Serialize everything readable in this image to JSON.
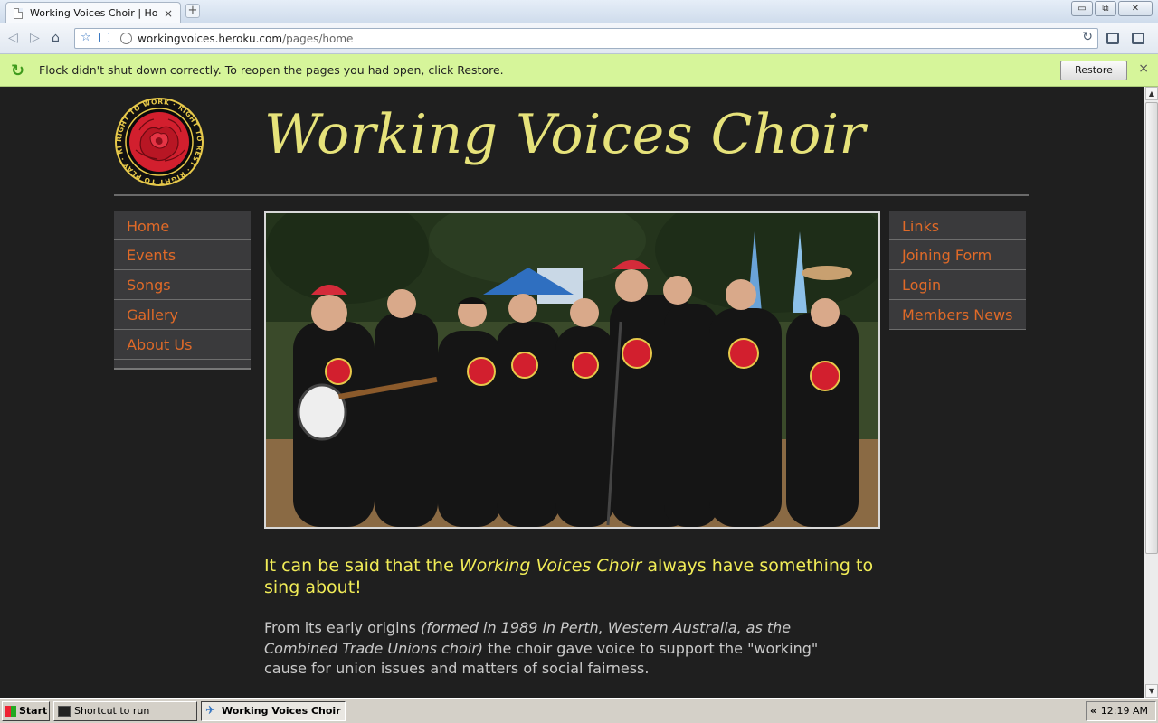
{
  "browser": {
    "tab_title": "Working Voices Choir | Home",
    "tab_close": "×",
    "new_tab": "+",
    "url_host": "workingvoices.heroku.com",
    "url_path": "/pages/home",
    "window_buttons": {
      "minimize": "▭",
      "restore": "⧉",
      "close": "✕"
    }
  },
  "infobar": {
    "message": "Flock didn't shut down correctly. To reopen the pages you had open, click Restore.",
    "restore_label": "Restore",
    "close": "×"
  },
  "site": {
    "title": "Working Voices Choir",
    "logo_text": "RIGHT TO WORK · RIGHT TO REST · RIGHT TO PLAY · RIGHTS FOR ALL",
    "colors": {
      "background": "#1f1f1f",
      "title": "#e6e27a",
      "nav_link": "#e06a28",
      "lead": "#f1ec57"
    },
    "left_nav": [
      "Home",
      "Events",
      "Songs",
      "Gallery",
      "About Us"
    ],
    "right_nav": [
      "Links",
      "Joining Form",
      "Login",
      "Members News"
    ],
    "lead_pre": "It can be said that the ",
    "lead_em": "Working Voices Choir",
    "lead_post": " always have something to sing about!",
    "body_pre": "From its early origins ",
    "body_em": "(formed in 1989 in Perth, Western Australia, as the Combined Trade Unions choir)",
    "body_post": " the choir gave voice to support the \"working\" cause for union issues and matters of social fairness."
  },
  "taskbar": {
    "start_label": "Start",
    "items": [
      "Shortcut to run",
      "Working Voices Choir ..."
    ],
    "tray_chevron": "«",
    "clock": "12:19 AM"
  }
}
